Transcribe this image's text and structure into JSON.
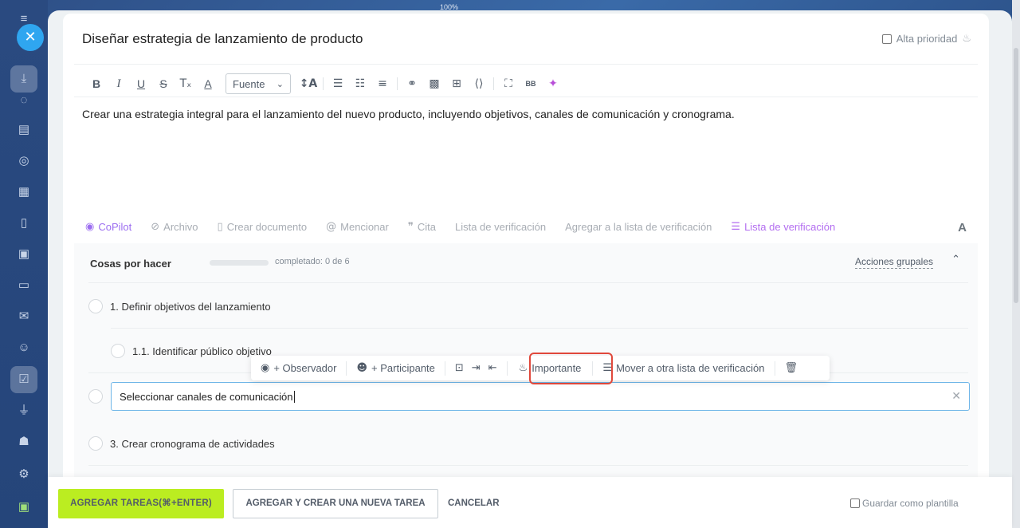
{
  "zoom": "100%",
  "task": {
    "title": "Diseñar estrategia de lanzamiento de producto",
    "high_priority_label": "Alta prioridad",
    "description": "Crear una estrategia integral para el lanzamiento del nuevo producto, incluyendo objetivos, canales de comunicación y cronograma."
  },
  "toolbar": {
    "bold": "B",
    "italic": "I",
    "underline": "U",
    "strike": "S",
    "clear": "Tₓ",
    "color": "A",
    "font_select": "Fuente",
    "font_size": "↕A",
    "bbcode": "BB"
  },
  "actions": {
    "copilot": "CoPilot",
    "file": "Archivo",
    "create_doc": "Crear documento",
    "mention": "Mencionar",
    "quote": "Cita",
    "checklist": "Lista de verificación",
    "add_to_checklist": "Agregar a la lista de verificación",
    "checklist_active": "Lista de verificación",
    "font": "A"
  },
  "checklist": {
    "title": "Cosas por hacer",
    "progress_text": "completado: 0 de 6",
    "progress_fraction": 0,
    "group_actions": "Acciones grupales",
    "items": [
      "1. Definir objetivos del lanzamiento",
      "1.1. Identificar público objetivo",
      "3. Crear cronograma de actividades"
    ],
    "editing_value": "Seleccionar canales de comunicación"
  },
  "item_toolbar": {
    "observer": "+ Observador",
    "participant": "+ Participante",
    "important": "Importante",
    "move": "Mover a otra lista de verificación"
  },
  "footer": {
    "add_tasks": "AGREGAR TAREAS(⌘+ENTER)",
    "add_and_new": "AGREGAR Y CREAR UNA NUEVA TAREA",
    "cancel": "CANCELAR",
    "save_template": "Guardar como plantilla"
  },
  "colors": {
    "primary_button": "#bbed21",
    "accent": "#2fa6f0",
    "highlight": "#e0483b"
  }
}
